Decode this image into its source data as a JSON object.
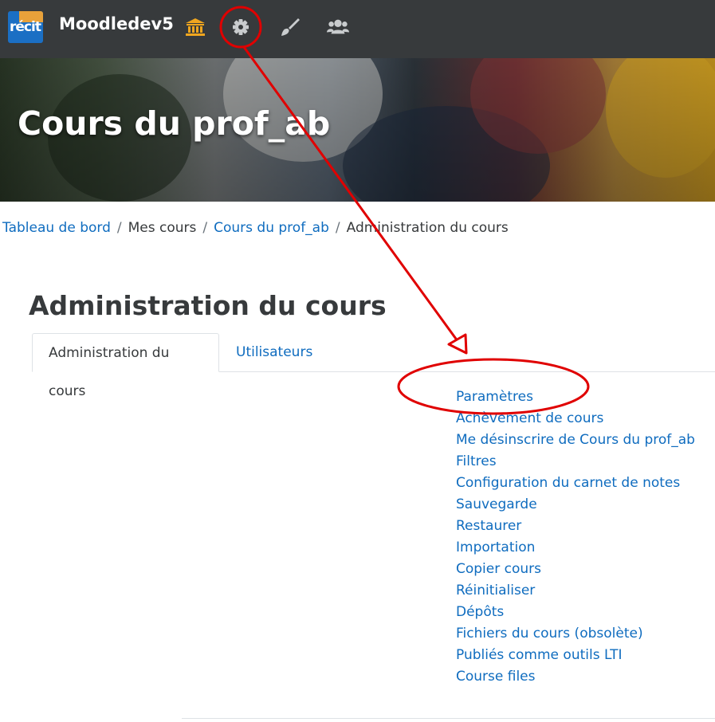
{
  "header": {
    "logo_text": "récit",
    "site_name": "Moodledev5",
    "icons": [
      "institution-icon",
      "gear-icon",
      "paintbrush-icon",
      "users-icon"
    ]
  },
  "hero": {
    "course_title": "Cours du prof_ab"
  },
  "breadcrumb": {
    "items": [
      {
        "label": "Tableau de bord",
        "link": true
      },
      {
        "label": "Mes cours",
        "link": false
      },
      {
        "label": "Cours du prof_ab",
        "link": true
      },
      {
        "label": "Administration du cours",
        "link": false
      }
    ],
    "separator": "/"
  },
  "main": {
    "title": "Administration du cours",
    "tabs": [
      {
        "label": "Administration du cours",
        "active": true
      },
      {
        "label": "Utilisateurs",
        "active": false
      }
    ],
    "links": [
      "Paramètres",
      "Achèvement de cours",
      "Me désinscrire de Cours du prof_ab",
      "Filtres",
      "Configuration du carnet de notes",
      "Sauvegarde",
      "Restaurer",
      "Importation",
      "Copier cours",
      "Réinitialiser",
      "Dépôts",
      "Fichiers du cours (obsolète)",
      "Publiés comme outils LTI",
      "Course files"
    ]
  },
  "colors": {
    "navbar": "#373a3c",
    "link": "#0f6cbf",
    "text": "#373a3c",
    "annotation": "#e00000",
    "institution_icon": "#f0a61f"
  }
}
